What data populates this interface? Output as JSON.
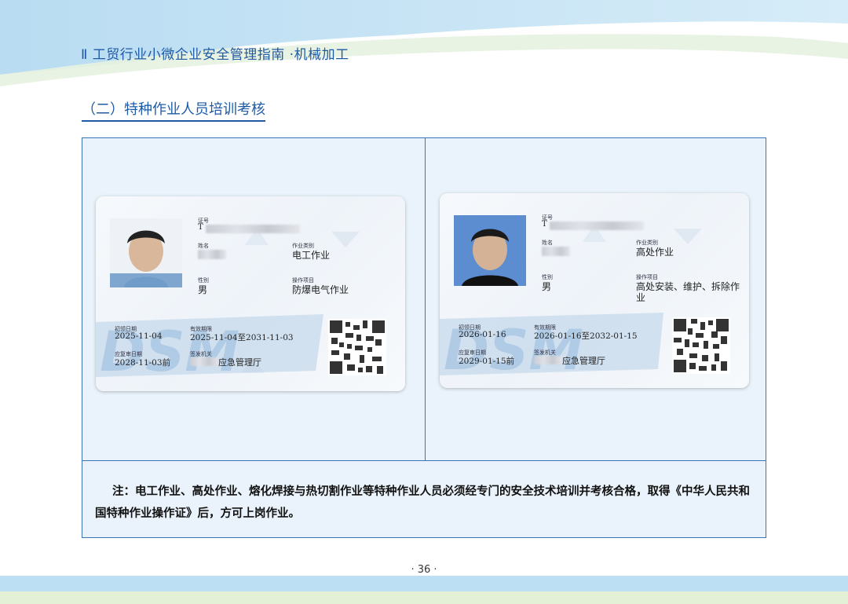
{
  "header": {
    "title": "Ⅱ 工贸行业小微企业安全管理指南  ·机械加工"
  },
  "section": {
    "title": "（二）特种作业人员培训考核"
  },
  "cards": [
    {
      "label_cert_no": "证号",
      "cert_no": "T",
      "label_name": "姓名",
      "label_gender": "性别",
      "gender": "男",
      "label_category": "作业类别",
      "category": "电工作业",
      "label_item": "操作项目",
      "item": "防爆电气作业",
      "label_first_date": "初领日期",
      "first_date": "2025-11-04",
      "label_valid": "有效期限",
      "valid": "2025-11-04至2031-11-03",
      "label_review": "应复审日期",
      "review": "2028-11-03前",
      "label_issuer": "签发机关",
      "issuer": "应急管理厅"
    },
    {
      "label_cert_no": "证号",
      "cert_no": "T",
      "label_name": "姓名",
      "label_gender": "性别",
      "gender": "男",
      "label_category": "作业类别",
      "category": "高处作业",
      "label_item": "操作项目",
      "item": "高处安装、维护、拆除作",
      "item2": "业",
      "label_first_date": "初领日期",
      "first_date": "2026-01-16",
      "label_valid": "有效期限",
      "valid": "2026-01-16至2032-01-15",
      "label_review": "应复审日期",
      "review": "2029-01-15前",
      "label_issuer": "签发机关",
      "issuer": "应急管理厅"
    }
  ],
  "note": {
    "text": "注：电工作业、高处作业、熔化焊接与热切割作业等特种作业人员必须经专门的安全技术培训并考核合格，取得《中华人民共和国特种作业操作证》后，方可上岗作业。"
  },
  "footer": {
    "page": "· 36 ·"
  },
  "colors": {
    "brand_blue": "#1f5aa6",
    "panel_bg": "#eaf3fb",
    "panel_border": "#3b73b9"
  }
}
